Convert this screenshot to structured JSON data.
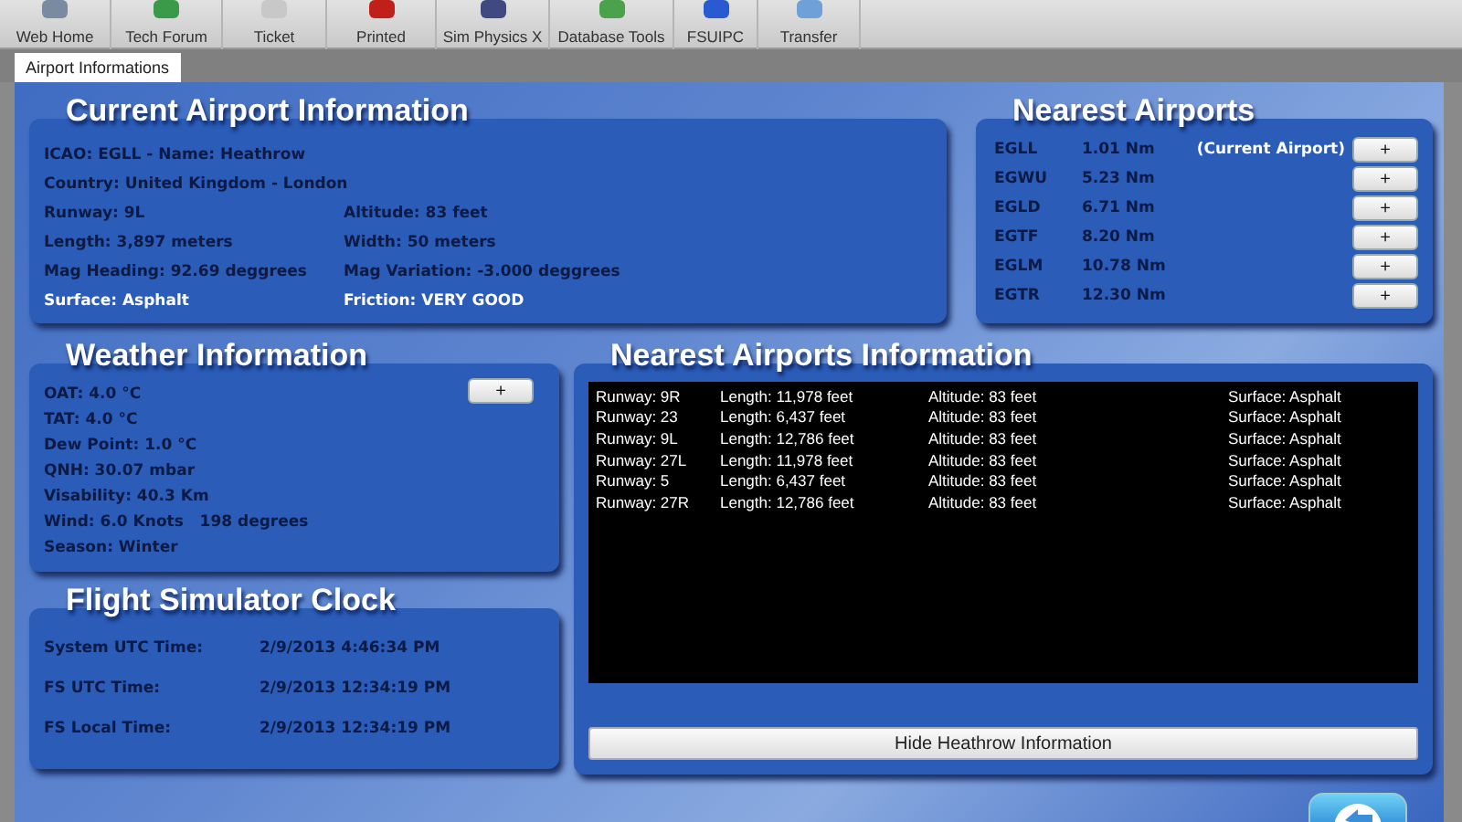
{
  "toolbar": [
    {
      "label": "Web Home"
    },
    {
      "label": "Tech Forum"
    },
    {
      "label": "Ticket"
    },
    {
      "label": "Printed"
    },
    {
      "label": "Sim Physics X"
    },
    {
      "label": "Database Tools"
    },
    {
      "label": "FSUIPC"
    },
    {
      "label": "Transfer"
    }
  ],
  "tabs": [
    {
      "label": "Airport Informations",
      "selected": true
    }
  ],
  "current_airport": {
    "title": "Current Airport Information",
    "rows": [
      {
        "cells": [
          {
            "text": "ICAO: EGLL - Name: Heathrow",
            "emphasized": false
          }
        ]
      },
      {
        "cells": [
          {
            "text": "Country: United Kingdom  -  London",
            "emphasized": false
          }
        ]
      },
      {
        "cells": [
          {
            "text": "Runway: 9L",
            "emphasized": false
          },
          {
            "text": "Altitude: 83 feet",
            "emphasized": false
          }
        ]
      },
      {
        "cells": [
          {
            "text": "Length: 3,897 meters",
            "emphasized": false
          },
          {
            "text": "Width: 50 meters",
            "emphasized": false
          }
        ]
      },
      {
        "cells": [
          {
            "text": "Mag Heading: 92.69 deggrees",
            "emphasized": false
          },
          {
            "text": "Mag Variation: -3.000 deggrees",
            "emphasized": false
          }
        ]
      },
      {
        "cells": [
          {
            "text": "Surface: Asphalt",
            "emphasized": true
          },
          {
            "text": "Friction: VERY GOOD",
            "emphasized": true
          }
        ]
      }
    ]
  },
  "nearest_airports": {
    "title": "Nearest Airports",
    "items": [
      {
        "icao": "EGLL",
        "distance": "1.01 Nm",
        "note": "(Current Airport)",
        "button": "+"
      },
      {
        "icao": "EGWU",
        "distance": "5.23 Nm",
        "button": "+"
      },
      {
        "icao": "EGLD",
        "distance": "6.71 Nm",
        "button": "+"
      },
      {
        "icao": "EGTF",
        "distance": "8.20 Nm",
        "button": "+"
      },
      {
        "icao": "EGLM",
        "distance": "10.78 Nm",
        "button": "+"
      },
      {
        "icao": "EGTR",
        "distance": "12.30 Nm",
        "button": "+"
      }
    ]
  },
  "weather": {
    "title": "Weather Information",
    "button": "+",
    "lines": [
      "OAT: 4.0 °C",
      "TAT: 4.0 °C",
      "Dew Point: 1.0 °C",
      "QNH: 30.07 mbar",
      "Visability: 40.3 Km",
      "Wind: 6.0 Knots   198 degrees",
      "Season: Winter"
    ]
  },
  "clock": {
    "title": "Flight Simulator Clock",
    "rows": [
      {
        "label": "System UTC Time:",
        "value": "2/9/2013 4:46:34 PM"
      },
      {
        "label": "FS UTC Time:",
        "value": "2/9/2013 12:34:19 PM"
      },
      {
        "label": "FS Local Time:",
        "value": "2/9/2013 12:34:19 PM"
      }
    ]
  },
  "runways": {
    "title": "Nearest Airports Information",
    "rows": [
      [
        "Runway: 9R",
        "Length: 11,978 feet",
        "Altitude: 83 feet",
        "Surface: Asphalt"
      ],
      [
        "Runway: 23",
        "Length: 6,437 feet",
        "Altitude: 83 feet",
        "Surface: Asphalt"
      ],
      [
        "Runway: 9L",
        "Length: 12,786 feet",
        "Altitude: 83 feet",
        "Surface: Asphalt"
      ],
      [
        "Runway: 27L",
        "Length: 11,978 feet",
        "Altitude: 83 feet",
        "Surface: Asphalt"
      ],
      [
        "Runway: 5",
        "Length: 6,437 feet",
        "Altitude: 83 feet",
        "Surface: Asphalt"
      ],
      [
        "Runway: 27R",
        "Length: 12,786 feet",
        "Altitude: 83 feet",
        "Surface: Asphalt"
      ]
    ],
    "button": "Hide Heathrow Information"
  }
}
